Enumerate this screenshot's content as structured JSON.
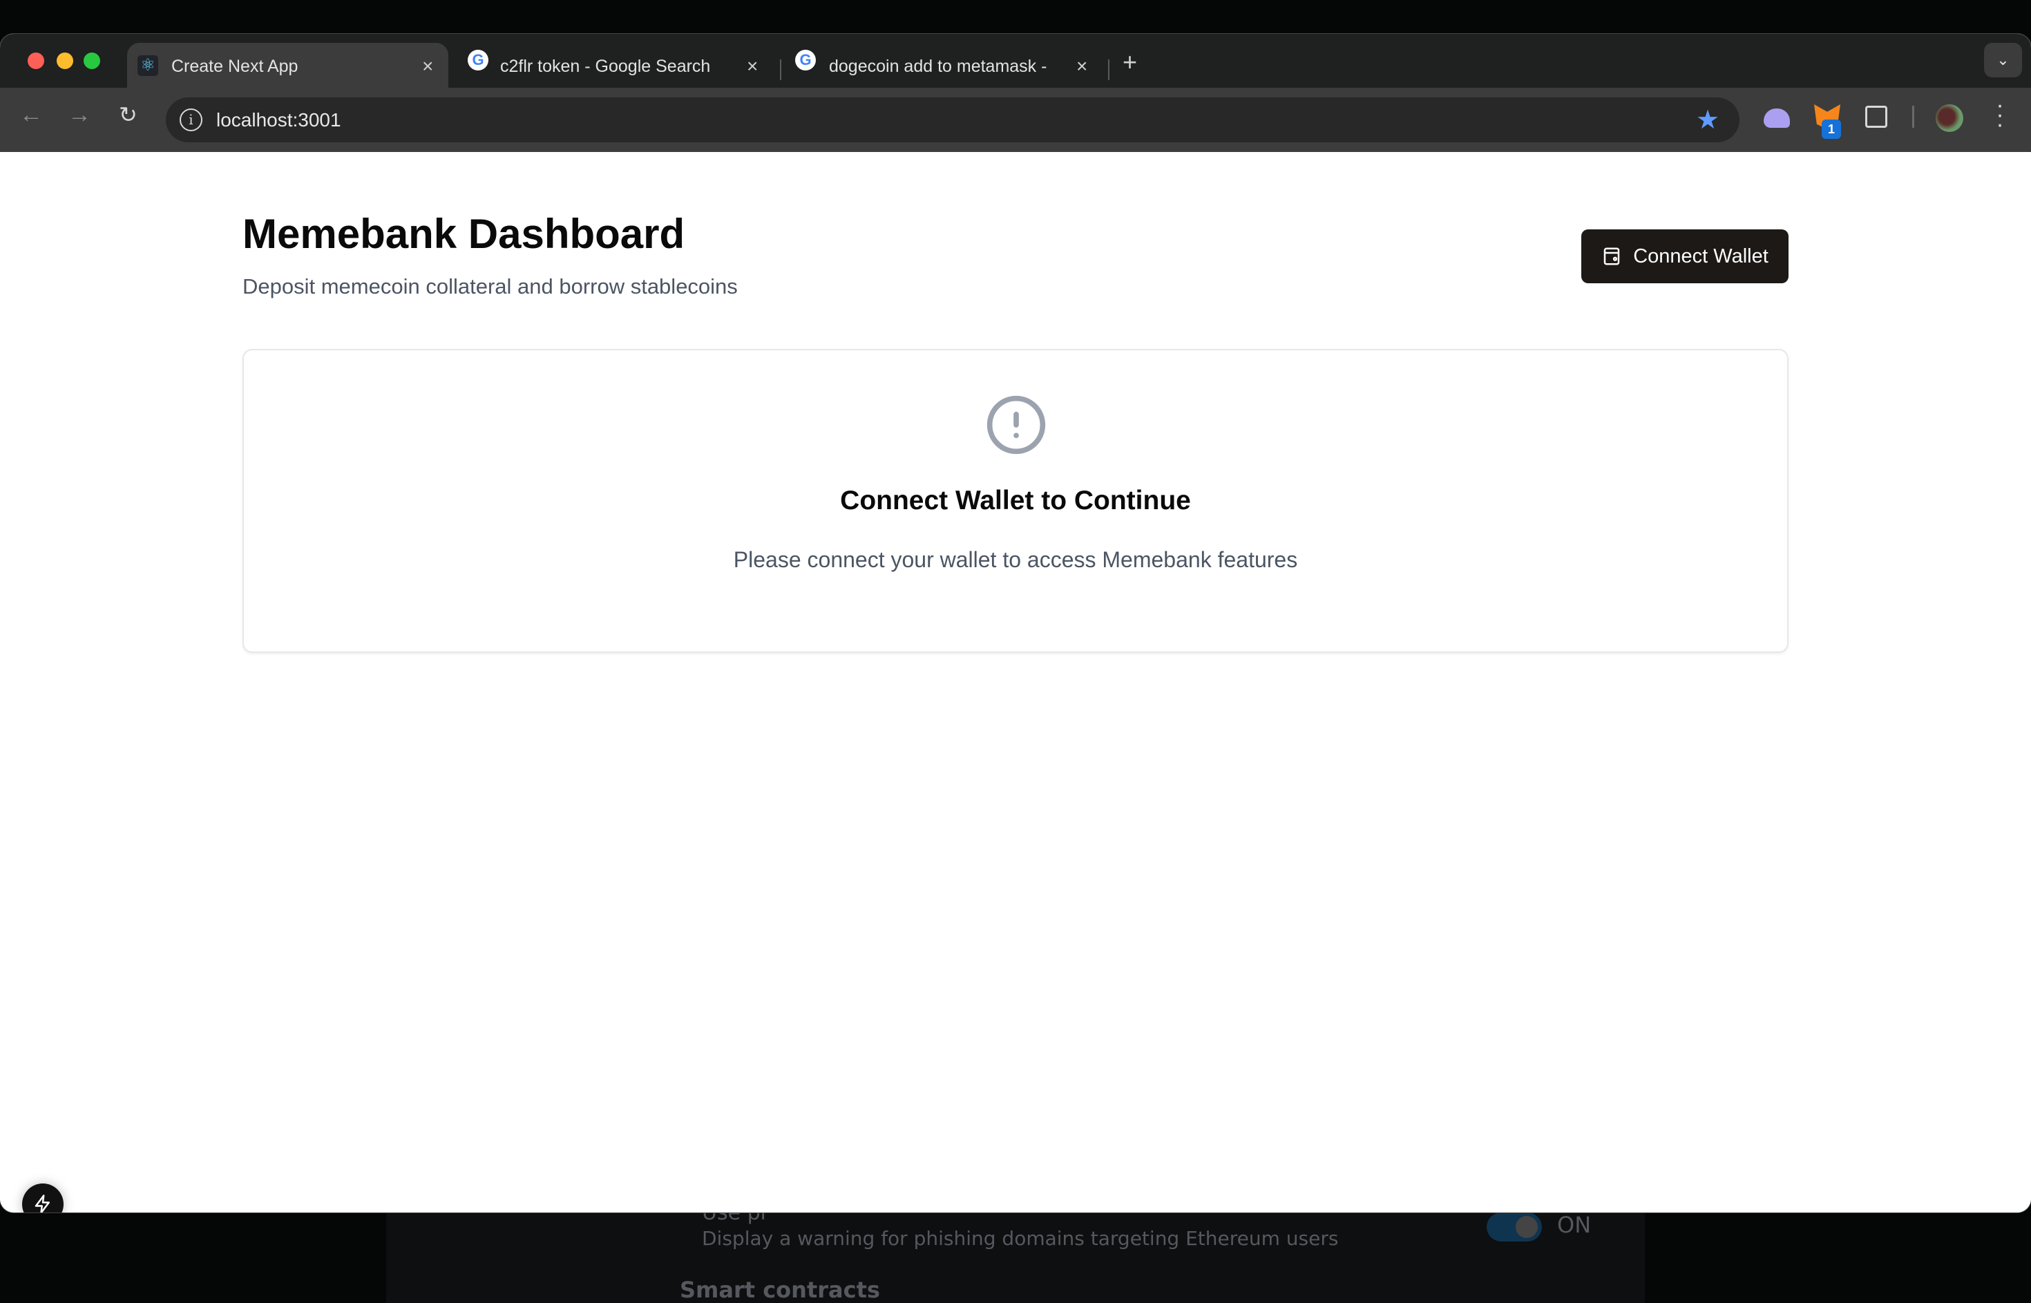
{
  "background": {
    "partial_label": "Use pr",
    "description": "Display a warning for phishing domains targeting Ethereum users",
    "toggle_label": "ON",
    "section": "Smart contracts"
  },
  "browser": {
    "tabs": [
      {
        "title": "Create Next App",
        "icon": "react-icon",
        "active": true
      },
      {
        "title": "c2flr token - Google Search",
        "icon": "google-icon",
        "active": false
      },
      {
        "title": "dogecoin add to metamask - ",
        "icon": "google-icon",
        "active": false
      }
    ],
    "url": "localhost:3001",
    "extension_badge": "1"
  },
  "page": {
    "title": "Memebank Dashboard",
    "subtitle": "Deposit memecoin collateral and borrow stablecoins",
    "connect_button": "Connect Wallet",
    "card": {
      "icon": "alert-circle-icon",
      "title": "Connect Wallet to Continue",
      "text": "Please connect your wallet to access Memebank features"
    }
  },
  "colors": {
    "button_bg": "#1c1917",
    "muted_text": "#4b5563",
    "star": "#5e9cff"
  }
}
